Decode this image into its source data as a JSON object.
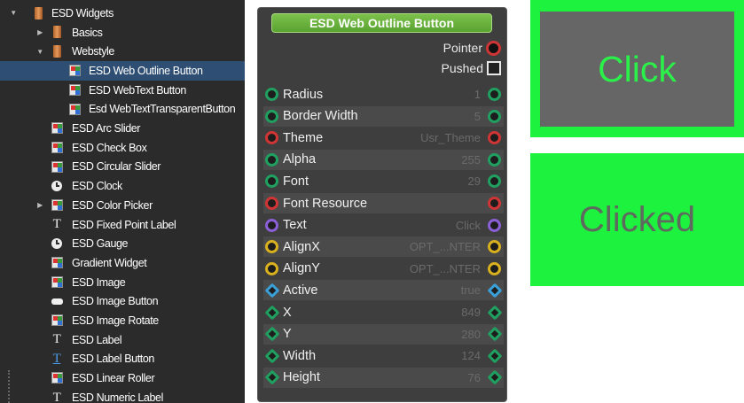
{
  "tree": {
    "items": [
      {
        "label": "ESD Widgets",
        "icon": "folder-icon",
        "expander": "expanded",
        "indent": 0
      },
      {
        "label": "Basics",
        "icon": "folder-icon",
        "expander": "collapsed",
        "indent": 1
      },
      {
        "label": "Webstyle",
        "icon": "folder-icon",
        "expander": "expanded",
        "indent": 1
      },
      {
        "label": "ESD Web Outline Button",
        "icon": "widget-icon",
        "expander": "none",
        "indent": 2,
        "selected": true
      },
      {
        "label": "ESD WebText Button",
        "icon": "widget-icon",
        "expander": "none",
        "indent": 2
      },
      {
        "label": "Esd WebTextTransparentButton",
        "icon": "widget-icon",
        "expander": "none",
        "indent": 2
      },
      {
        "label": "ESD Arc Slider",
        "icon": "widget-icon",
        "expander": "none",
        "indent": 1
      },
      {
        "label": "ESD Check Box",
        "icon": "widget-icon",
        "expander": "none",
        "indent": 1
      },
      {
        "label": "ESD Circular Slider",
        "icon": "widget-icon",
        "expander": "none",
        "indent": 1
      },
      {
        "label": "ESD Clock",
        "icon": "clock-icon",
        "expander": "none",
        "indent": 1
      },
      {
        "label": "ESD Color Picker",
        "icon": "widget-icon",
        "expander": "collapsed",
        "indent": 1
      },
      {
        "label": "ESD Fixed Point Label",
        "icon": "text-icon",
        "expander": "none",
        "indent": 1
      },
      {
        "label": "ESD Gauge",
        "icon": "clock-icon",
        "expander": "none",
        "indent": 1
      },
      {
        "label": "Gradient Widget",
        "icon": "widget-icon",
        "expander": "none",
        "indent": 1
      },
      {
        "label": "ESD Image",
        "icon": "widget-icon",
        "expander": "none",
        "indent": 1
      },
      {
        "label": "ESD Image Button",
        "icon": "button-icon",
        "expander": "none",
        "indent": 1
      },
      {
        "label": "ESD Image Rotate",
        "icon": "widget-icon",
        "expander": "none",
        "indent": 1
      },
      {
        "label": "ESD Label",
        "icon": "text-icon",
        "expander": "none",
        "indent": 1
      },
      {
        "label": "ESD Label Button",
        "icon": "text-link-icon",
        "expander": "none",
        "indent": 1
      },
      {
        "label": "ESD Linear Roller",
        "icon": "widget-icon",
        "expander": "none",
        "indent": 1
      },
      {
        "label": "ESD Numeric Label",
        "icon": "text-icon",
        "expander": "none",
        "indent": 1
      }
    ]
  },
  "node": {
    "title": "ESD Web Outline Button",
    "outputs": [
      {
        "label": "Pointer",
        "pin": "red-circle"
      },
      {
        "label": "Pushed",
        "pin": "checkbox"
      }
    ],
    "properties": [
      {
        "name": "Radius",
        "value": "1",
        "color": "#20a060",
        "shape": "circle"
      },
      {
        "name": "Border Width",
        "value": "5",
        "color": "#20a060",
        "shape": "circle"
      },
      {
        "name": "Theme",
        "value": "Usr_Theme",
        "color": "#d03535",
        "shape": "circle"
      },
      {
        "name": "Alpha",
        "value": "255",
        "color": "#20a060",
        "shape": "circle"
      },
      {
        "name": "Font",
        "value": "29",
        "color": "#20a060",
        "shape": "circle"
      },
      {
        "name": "Font Resource",
        "value": "",
        "color": "#d03535",
        "shape": "circle"
      },
      {
        "name": "Text",
        "value": "Click",
        "color": "#8b5fd6",
        "shape": "circle"
      },
      {
        "name": "AlignX",
        "value": "OPT_...NTER",
        "color": "#d9b01e",
        "shape": "circle"
      },
      {
        "name": "AlignY",
        "value": "OPT_...NTER",
        "color": "#d9b01e",
        "shape": "circle"
      },
      {
        "name": "Active",
        "value": "true",
        "color": "#3a9fd6",
        "shape": "diamond"
      },
      {
        "name": "X",
        "value": "849",
        "color": "#20a060",
        "shape": "diamond"
      },
      {
        "name": "Y",
        "value": "280",
        "color": "#20a060",
        "shape": "diamond"
      },
      {
        "name": "Width",
        "value": "124",
        "color": "#20a060",
        "shape": "diamond"
      },
      {
        "name": "Height",
        "value": "76",
        "color": "#20a060",
        "shape": "diamond"
      }
    ]
  },
  "previews": {
    "normal": {
      "label": "Click",
      "border_color": "#1df23f",
      "fill_color": "#666666",
      "text_color": "#2bf04a"
    },
    "pushed": {
      "label": "Clicked",
      "fill_color": "#1df23f",
      "text_color": "#5e6a5e"
    }
  }
}
